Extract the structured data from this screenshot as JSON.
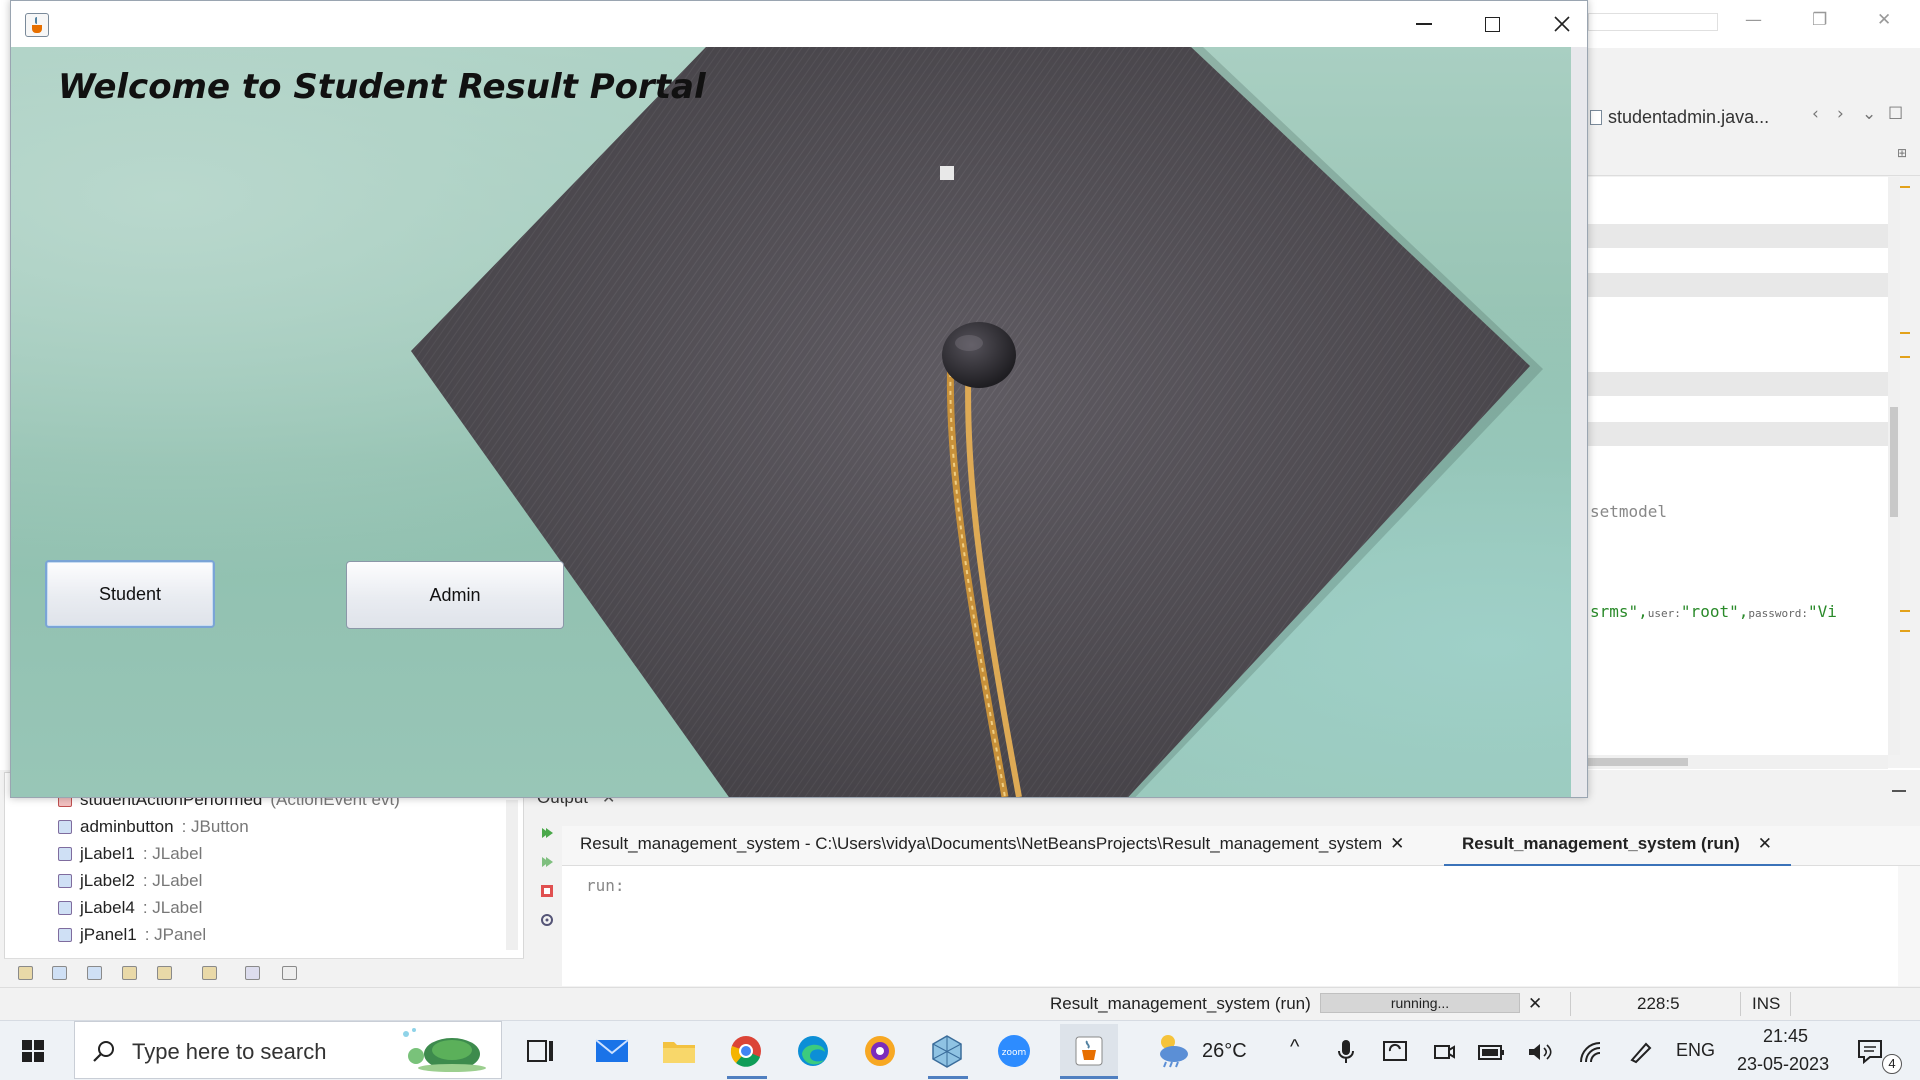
{
  "app_window": {
    "welcome_text": "Welcome to Student Result Portal",
    "student_button": "Student",
    "admin_button": "Admin"
  },
  "ide": {
    "editor_tab": "studentadmin.java...",
    "code_setmodel": "setmodel",
    "code_conn_1": "srms\",",
    "code_conn_user_label": "user:",
    "code_conn_user": "\"root\",",
    "code_conn_pass_label": "password:",
    "code_conn_pass": "\"Vi",
    "navigator_items": [
      {
        "name": "studentActionPerformed",
        "type": "(ActionEvent evt)"
      },
      {
        "name": "adminbutton",
        "type": " : JButton"
      },
      {
        "name": "jLabel1",
        "type": " : JLabel"
      },
      {
        "name": "jLabel2",
        "type": " : JLabel"
      },
      {
        "name": "jLabel4",
        "type": " : JLabel"
      },
      {
        "name": "jPanel1",
        "type": " : JPanel"
      }
    ],
    "output_title": "Output",
    "output_tab_1": "Result_management_system - C:\\Users\\vidya\\Documents\\NetBeansProjects\\Result_management_system",
    "output_tab_2": "Result_management_system (run)",
    "output_text": "run:",
    "status_project": "Result_management_system (run)",
    "status_progress": "running...",
    "status_position": "228:5",
    "status_mode": "INS"
  },
  "taskbar": {
    "search_placeholder": "Type here to search",
    "weather": "26°C",
    "language": "ENG",
    "time": "21:45",
    "date": "23-05-2023",
    "notification_count": "4"
  },
  "colors": {
    "accent": "#3b73b9",
    "cap_fabric": "#5e5a60",
    "tassel": "#d6a24a",
    "chalkboard": "#9fc8b9"
  }
}
